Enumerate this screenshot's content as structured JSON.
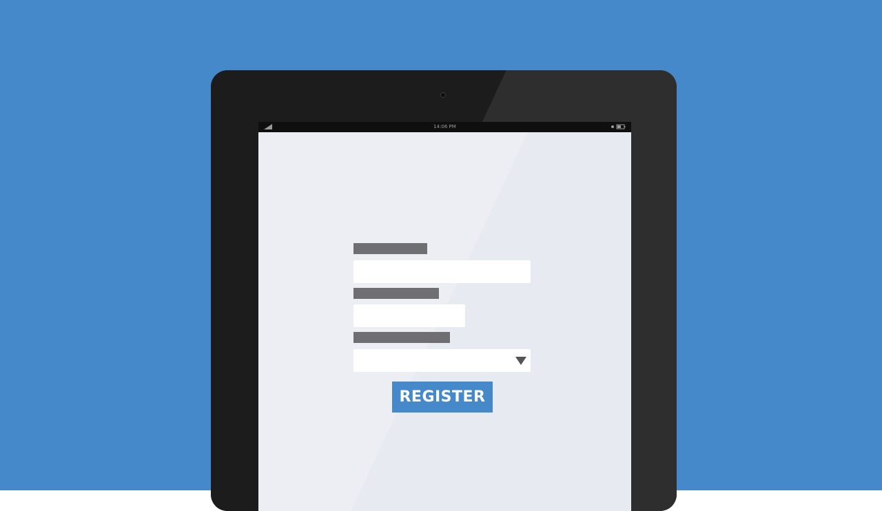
{
  "status_bar": {
    "time": "14:06 PM",
    "signal_icon": "signal-icon",
    "battery_icon": "battery-icon"
  },
  "form": {
    "fields": [
      {
        "type": "text",
        "value": ""
      },
      {
        "type": "text",
        "value": ""
      },
      {
        "type": "select",
        "value": "",
        "icon": "dropdown-arrow-icon"
      }
    ],
    "submit_label": "REGISTER"
  },
  "colors": {
    "background": "#4589cb",
    "device_bezel": "#262626",
    "screen": "#eceef3",
    "label_placeholder": "#6f6f72",
    "button": "#4589cb",
    "button_text": "#ffffff"
  }
}
